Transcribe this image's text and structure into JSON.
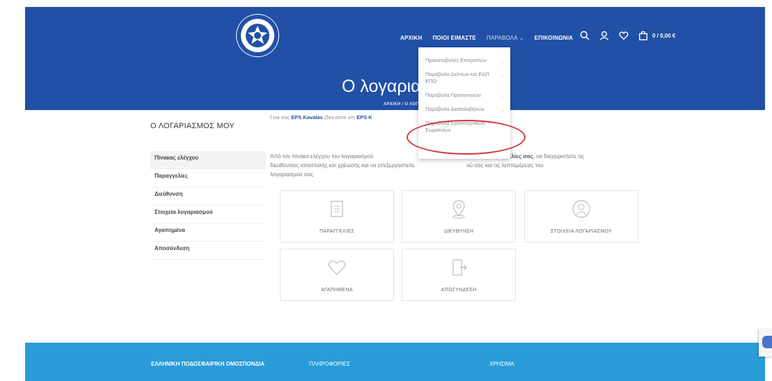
{
  "header": {
    "nav": [
      "ΑΡΧΙΚΗ",
      "ΠΟΙΟΙ ΕΙΜΑΣΤΕ",
      "ΠΑΡΑΒΟΛΑ",
      "ΕΠΙΚΟΙΝΩΝΙΑ"
    ],
    "nav_dropdown_indicator": "⌄",
    "cart_total": "0 / 0,00 €",
    "page_title": "Ο λογαριασμ",
    "breadcrumb": "ΑΡΧΙΚΗ / Ο ΛΟΓΑΡΙΑΣΜΟ"
  },
  "dropdown": {
    "items": [
      "Προκαταβολές Επιτροπών",
      "Παράβολα Δελτίων και ΕΔΠ ΕΠΟ",
      "Παράβολα Προπονητών",
      "Παράβολα Διαιτολαβητών",
      "Παράβολα Ερασιτεχνικών Σωματείων"
    ]
  },
  "account": {
    "section_title": "Ο ΛΟΓΑΡΙΑΣΜΟΣ ΜΟΥ",
    "welcome_prefix": "Γεια σας",
    "welcome_user": "EPS Kavalas",
    "welcome_middle": "(δεν είστε ο/η",
    "welcome_user2": "EPS K",
    "desc_start": "Από τον πίνακα ελέγχου του λογαριασμού",
    "desc_bold": "ες παραγγελίες σας",
    "desc_mid": ", να διαχειριστείτε τις",
    "desc_line2_a": "διευθύνσεις αποστολής και χρέωσης και να επεξεργαστείτε",
    "desc_line2_b": "ού σας και τις λεπτομέρειες του",
    "desc_line3": "λογαριασμού σας."
  },
  "sidebar": {
    "items": [
      "Πίνακας ελέγχου",
      "Παραγγελίες",
      "Διεύθυνση",
      "Στοιχεία λογαριασμού",
      "Αγαπημένα",
      "Αποσύνδεση"
    ]
  },
  "tiles": [
    "ΠΑΡΑΓΓΕΛΙΕΣ",
    "ΔΙΕΥΘΥΝΣΗ",
    "ΣΤΟΙΧΕΙΑ ΛΟΓΑΡΙΑΣΜΟΥ",
    "ΑΓΑΠΗΜΕΝΑ",
    "ΑΠΟΣΥΝΔΕΣΗ"
  ],
  "footer": {
    "col1": "ΕΛΛΗΝΙΚΗ ΠΟΔΟΣΦΑΙΡΙΚΗ ΟΜΟΣΠΟΝΔΙΑ",
    "col2": "ΠΛΗΡΟΦΟΡΙΕΣ",
    "col3": "ΧΡΗΣΙΜΑ"
  },
  "colors": {
    "header_blue": "#2150a6",
    "footer_blue": "#2a9cd8",
    "highlight_red": "#d0363a"
  },
  "icons": [
    "logo",
    "search-icon",
    "user-icon",
    "heart-icon",
    "bag-icon",
    "document-icon",
    "location-pin-icon",
    "user-circle-icon",
    "heart-outline-icon",
    "logout-door-icon",
    "chevron-right-icon",
    "recaptcha-icon"
  ]
}
